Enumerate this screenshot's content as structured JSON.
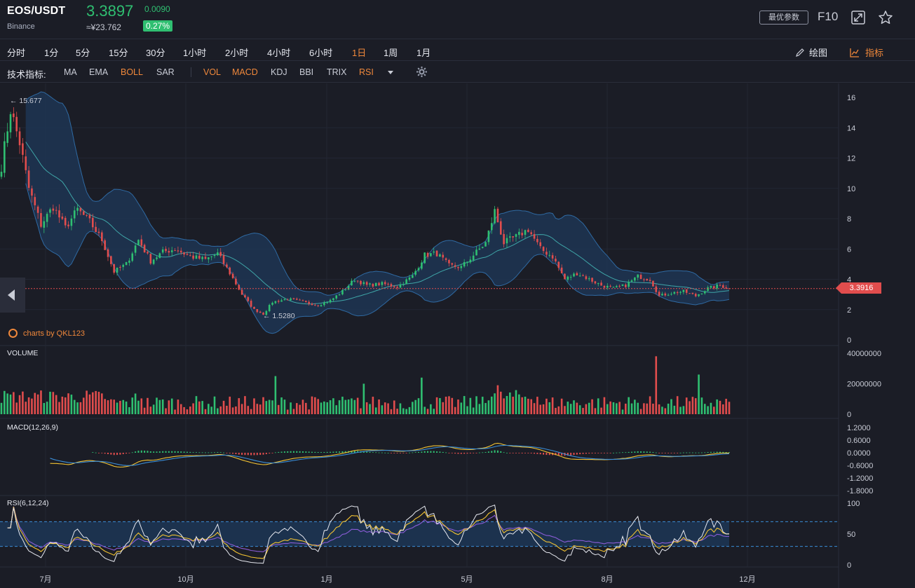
{
  "header": {
    "pair": "EOS/USDT",
    "exchange": "Binance",
    "price": "3.3897",
    "change": "0.0090",
    "cny_price": "≈¥23.762",
    "change_pct": "0.27%",
    "params_button": "最优参数",
    "f10_button": "F10"
  },
  "timeframes": [
    "分时",
    "1分",
    "5分",
    "15分",
    "30分",
    "1小时",
    "2小时",
    "4小时",
    "6小时",
    "1日",
    "1周",
    "1月"
  ],
  "active_timeframe": "1日",
  "toolbar": {
    "draw_label": "绘图",
    "indicator_label": "指标"
  },
  "indicators": {
    "label": "技术指标:",
    "main": [
      {
        "name": "MA",
        "active": false
      },
      {
        "name": "EMA",
        "active": false
      },
      {
        "name": "BOLL",
        "active": true
      },
      {
        "name": "SAR",
        "active": false
      }
    ],
    "sub": [
      {
        "name": "VOL",
        "active": true
      },
      {
        "name": "MACD",
        "active": true
      },
      {
        "name": "KDJ",
        "active": false
      },
      {
        "name": "BBI",
        "active": false
      },
      {
        "name": "TRIX",
        "active": false
      },
      {
        "name": "RSI",
        "active": true
      }
    ]
  },
  "watermark": "charts by QKL123",
  "colors": {
    "up": "#2fbf71",
    "down": "#e14d4d",
    "accent": "#f0883b",
    "boll_fill": "#1d3553",
    "boll_mid": "#3fa6a8"
  },
  "chart_data": [
    {
      "type": "candlestick",
      "title": "EOS/USDT",
      "indicator": "BOLL",
      "ylim": [
        0,
        16
      ],
      "y_ticks": [
        "0",
        "2",
        "4",
        "6",
        "8",
        "10",
        "12",
        "14",
        "16"
      ],
      "x_ticks": [
        "7月",
        "10月",
        "1月",
        "5月",
        "8月",
        "12月"
      ],
      "high_marker": "15.677",
      "low_marker": "1.5280",
      "last_price": "3.3916",
      "close_path": [
        {
          "i": 0,
          "v": 11.5
        },
        {
          "i": 3,
          "v": 15.2
        },
        {
          "i": 6,
          "v": 13.0
        },
        {
          "i": 9,
          "v": 10.0
        },
        {
          "i": 13,
          "v": 7.6
        },
        {
          "i": 17,
          "v": 8.8
        },
        {
          "i": 21,
          "v": 7.4
        },
        {
          "i": 25,
          "v": 8.6
        },
        {
          "i": 29,
          "v": 7.8
        },
        {
          "i": 33,
          "v": 6.6
        },
        {
          "i": 37,
          "v": 4.5
        },
        {
          "i": 41,
          "v": 5.0
        },
        {
          "i": 45,
          "v": 6.6
        },
        {
          "i": 49,
          "v": 5.2
        },
        {
          "i": 53,
          "v": 5.8
        },
        {
          "i": 57,
          "v": 6.0
        },
        {
          "i": 62,
          "v": 5.5
        },
        {
          "i": 67,
          "v": 5.3
        },
        {
          "i": 71,
          "v": 5.7
        },
        {
          "i": 75,
          "v": 4.4
        },
        {
          "i": 79,
          "v": 3.0
        },
        {
          "i": 83,
          "v": 2.0
        },
        {
          "i": 86,
          "v": 1.7
        },
        {
          "i": 89,
          "v": 2.5
        },
        {
          "i": 94,
          "v": 2.7
        },
        {
          "i": 99,
          "v": 2.5
        },
        {
          "i": 104,
          "v": 2.3
        },
        {
          "i": 108,
          "v": 2.6
        },
        {
          "i": 112,
          "v": 3.2
        },
        {
          "i": 116,
          "v": 4.0
        },
        {
          "i": 120,
          "v": 3.6
        },
        {
          "i": 125,
          "v": 3.7
        },
        {
          "i": 130,
          "v": 3.5
        },
        {
          "i": 135,
          "v": 4.2
        },
        {
          "i": 139,
          "v": 5.6
        },
        {
          "i": 143,
          "v": 5.7
        },
        {
          "i": 147,
          "v": 4.9
        },
        {
          "i": 151,
          "v": 4.8
        },
        {
          "i": 155,
          "v": 5.6
        },
        {
          "i": 159,
          "v": 6.4
        },
        {
          "i": 162,
          "v": 8.5
        },
        {
          "i": 165,
          "v": 6.4
        },
        {
          "i": 169,
          "v": 6.8
        },
        {
          "i": 173,
          "v": 7.3
        },
        {
          "i": 177,
          "v": 6.0
        },
        {
          "i": 181,
          "v": 5.5
        },
        {
          "i": 185,
          "v": 4.0
        },
        {
          "i": 189,
          "v": 4.4
        },
        {
          "i": 193,
          "v": 4.0
        },
        {
          "i": 197,
          "v": 3.6
        },
        {
          "i": 201,
          "v": 3.4
        },
        {
          "i": 205,
          "v": 3.6
        },
        {
          "i": 209,
          "v": 4.2
        },
        {
          "i": 213,
          "v": 4.0
        },
        {
          "i": 216,
          "v": 2.9
        },
        {
          "i": 220,
          "v": 3.1
        },
        {
          "i": 224,
          "v": 3.2
        },
        {
          "i": 228,
          "v": 2.9
        },
        {
          "i": 232,
          "v": 3.4
        },
        {
          "i": 236,
          "v": 3.6
        },
        {
          "i": 239,
          "v": 3.39
        }
      ]
    },
    {
      "type": "bar",
      "title": "VOLUME",
      "ylim": [
        0,
        40000000
      ],
      "y_ticks": [
        "40000000",
        "20000000",
        "0"
      ],
      "peaks": [
        {
          "i": 90,
          "v": 25000000
        },
        {
          "i": 119,
          "v": 20000000
        },
        {
          "i": 138,
          "v": 24000000
        },
        {
          "i": 163,
          "v": 19000000
        },
        {
          "i": 215,
          "v": 38000000
        },
        {
          "i": 229,
          "v": 26000000
        }
      ]
    },
    {
      "type": "line",
      "title": "MACD(12,26,9)",
      "ylim": [
        -2.1,
        1.5
      ],
      "y_ticks": [
        "1.2000",
        "0.6000",
        "0.0000",
        "-0.6000",
        "-1.2000",
        "-1.8000"
      ]
    },
    {
      "type": "line",
      "title": "RSI(6,12,24)",
      "ylim": [
        0,
        100
      ],
      "y_ticks": [
        "100",
        "50",
        "0"
      ],
      "bands": [
        30,
        70
      ]
    }
  ]
}
